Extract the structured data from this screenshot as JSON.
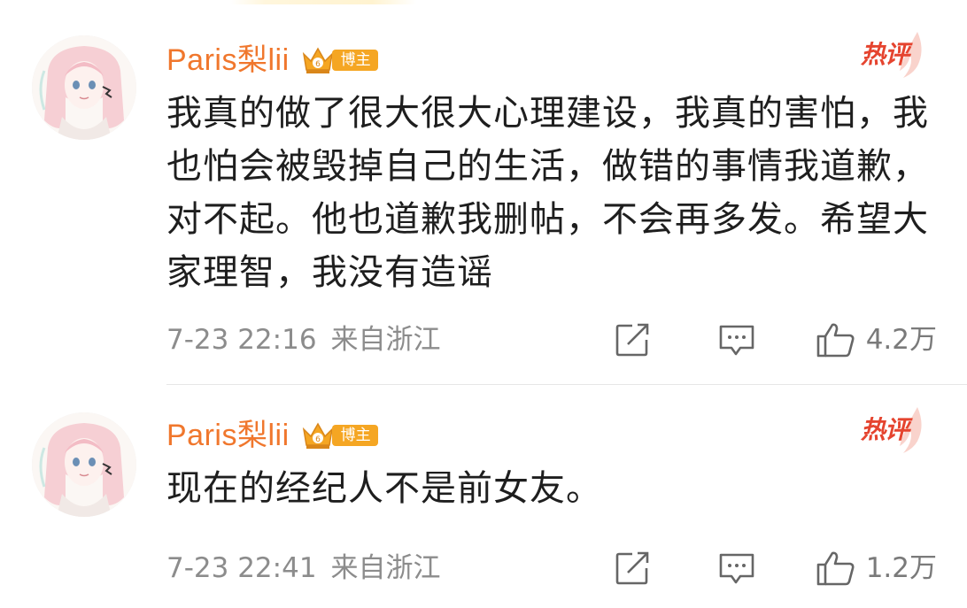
{
  "comments": [
    {
      "username": "Paris梨lii",
      "badge_label": "博主",
      "hot_label": "热评",
      "text": "我真的做了很大很大心理建设，我真的害怕，我也怕会被毁掉自己的生活，做错的事情我道歉，对不起。他也道歉我删帖，不会再多发。希望大家理智，我没有造谣",
      "time": "7-23 22:16",
      "location": "来自浙江",
      "likes": "4.2万"
    },
    {
      "username": "Paris梨lii",
      "badge_label": "博主",
      "hot_label": "热评",
      "text": "现在的经纪人不是前女友。",
      "time": "7-23 22:41",
      "location": "来自浙江",
      "likes": "1.2万"
    }
  ],
  "colors": {
    "username": "#f0772d",
    "badge": "#f5a623",
    "hot": "#e5442f",
    "text": "#1e1e1e",
    "meta": "#8c8c8c"
  },
  "icons": {
    "share": "share-icon",
    "reply": "comment-icon",
    "like": "thumbs-up-icon",
    "vip": "crown-icon"
  }
}
